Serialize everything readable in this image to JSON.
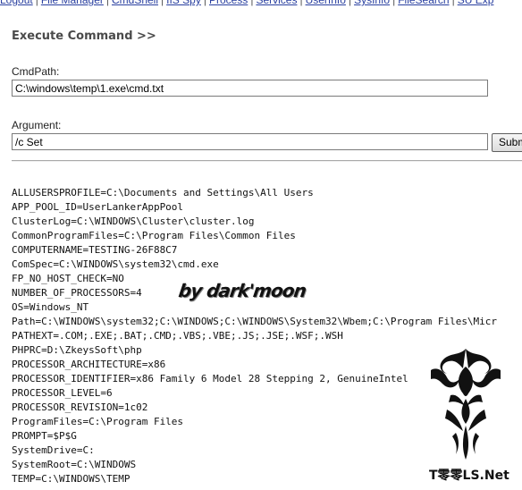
{
  "nav": {
    "items": [
      "Logout",
      "File Manager",
      "CmdShell",
      "IIS Spy",
      "Process",
      "Services",
      "UserInfo",
      "SysInfo",
      "FileSearch",
      "SU Exp"
    ],
    "separator": "|"
  },
  "title": "Execute Command >>",
  "cmdpath": {
    "label": "CmdPath:",
    "value": "C:\\windows\\temp\\1.exe\\cmd.txt"
  },
  "argument": {
    "label": "Argument:",
    "value": "/c Set"
  },
  "submit_label": "Submit",
  "output_lines": [
    "ALLUSERSPROFILE=C:\\Documents and Settings\\All Users",
    "APP_POOL_ID=UserLankerAppPool",
    "ClusterLog=C:\\WINDOWS\\Cluster\\cluster.log",
    "CommonProgramFiles=C:\\Program Files\\Common Files",
    "COMPUTERNAME=TESTING-26F88C7",
    "ComSpec=C:\\WINDOWS\\system32\\cmd.exe",
    "FP_NO_HOST_CHECK=NO",
    "NUMBER_OF_PROCESSORS=4",
    "OS=Windows_NT",
    "Path=C:\\WINDOWS\\system32;C:\\WINDOWS;C:\\WINDOWS\\System32\\Wbem;C:\\Program Files\\Micr",
    "PATHEXT=.COM;.EXE;.BAT;.CMD;.VBS;.VBE;.JS;.JSE;.WSF;.WSH",
    "PHPRC=D:\\ZkeysSoft\\php",
    "PROCESSOR_ARCHITECTURE=x86",
    "PROCESSOR_IDENTIFIER=x86 Family 6 Model 28 Stepping 2, GenuineIntel",
    "PROCESSOR_LEVEL=6",
    "PROCESSOR_REVISION=1c02",
    "ProgramFiles=C:\\Program Files",
    "PROMPT=$P$G",
    "SystemDrive=C:",
    "SystemRoot=C:\\WINDOWS",
    "TEMP=C:\\WINDOWS\\TEMP"
  ],
  "watermark": "by dark'moon",
  "brand": "T零零LS.Net",
  "colors": {
    "link": "#2a40a0",
    "title": "#4a4a4a"
  }
}
